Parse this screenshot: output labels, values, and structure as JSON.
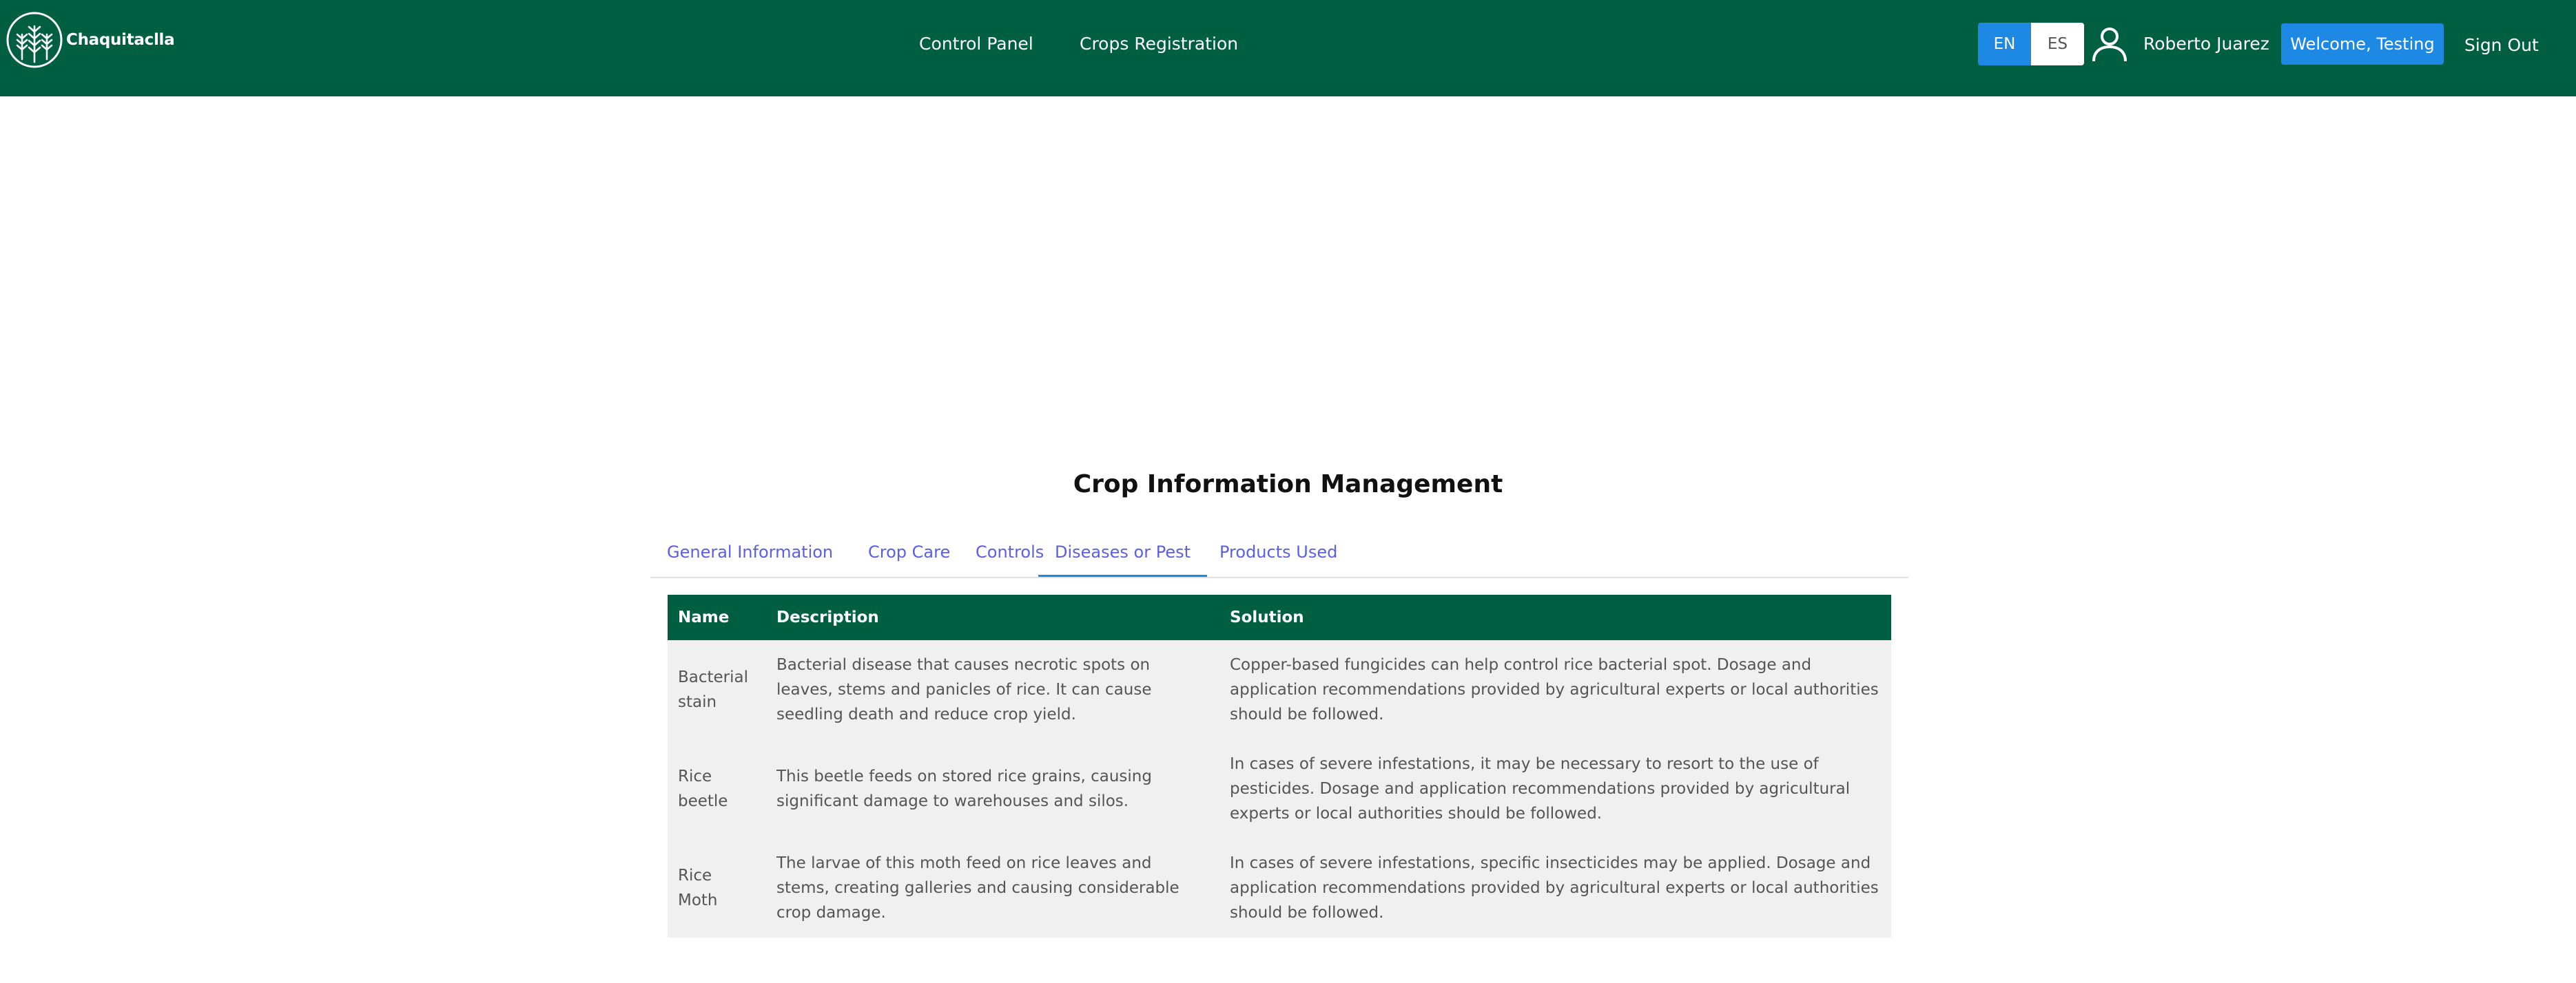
{
  "brand": {
    "name": "Chaquitaclla",
    "logo_icon": "wheat-logo-icon"
  },
  "nav": {
    "links": [
      "Control Panel",
      "Crops Registration"
    ],
    "lang_en": "EN",
    "lang_es": "ES",
    "user_icon": "user-icon",
    "user_name": "Roberto Juarez",
    "welcome": "Welcome, Testing",
    "sign_out": "Sign Out"
  },
  "page": {
    "title": "Crop Information Management",
    "tabs": [
      "General Information",
      "Crop Care",
      "Controls",
      "Diseases or Pest",
      "Products Used"
    ],
    "active_tab": "Diseases or Pest"
  },
  "table": {
    "headers": [
      "Name",
      "Description",
      "Solution"
    ],
    "rows": [
      {
        "name": "Bacterial stain",
        "description": "Bacterial disease that causes necrotic spots on leaves, stems and panicles of rice. It can cause seedling death and reduce crop yield.",
        "solution": "Copper-based fungicides can help control rice bacterial spot. Dosage and application recommendations provided by agricultural experts or local authorities should be followed."
      },
      {
        "name": "Rice beetle",
        "description": "This beetle feeds on stored rice grains, causing significant damage to warehouses and silos.",
        "solution": "In cases of severe infestations, it may be necessary to resort to the use of pesticides. Dosage and application recommendations provided by agricultural experts or local authorities should be followed."
      },
      {
        "name": "Rice Moth",
        "description": "The larvae of this moth feed on rice leaves and stems, creating galleries and causing considerable crop damage.",
        "solution": "In cases of severe infestations, specific insecticides may be applied. Dosage and application recommendations provided by agricultural experts or local authorities should be followed."
      }
    ]
  },
  "colors": {
    "header_green": "#005f40",
    "accent_blue": "#1e88e5",
    "tab_text": "#5a5fe6",
    "row_bg": "#f0f0f0"
  }
}
